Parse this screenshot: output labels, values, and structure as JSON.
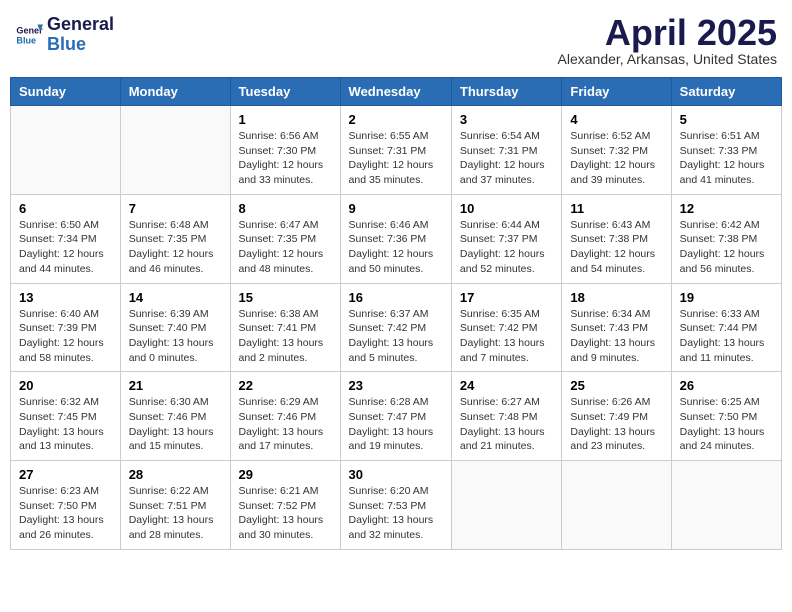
{
  "header": {
    "logo_line1": "General",
    "logo_line2": "Blue",
    "month_title": "April 2025",
    "location": "Alexander, Arkansas, United States"
  },
  "days_of_week": [
    "Sunday",
    "Monday",
    "Tuesday",
    "Wednesday",
    "Thursday",
    "Friday",
    "Saturday"
  ],
  "weeks": [
    [
      {
        "day": "",
        "info": ""
      },
      {
        "day": "",
        "info": ""
      },
      {
        "day": "1",
        "info": "Sunrise: 6:56 AM\nSunset: 7:30 PM\nDaylight: 12 hours and 33 minutes."
      },
      {
        "day": "2",
        "info": "Sunrise: 6:55 AM\nSunset: 7:31 PM\nDaylight: 12 hours and 35 minutes."
      },
      {
        "day": "3",
        "info": "Sunrise: 6:54 AM\nSunset: 7:31 PM\nDaylight: 12 hours and 37 minutes."
      },
      {
        "day": "4",
        "info": "Sunrise: 6:52 AM\nSunset: 7:32 PM\nDaylight: 12 hours and 39 minutes."
      },
      {
        "day": "5",
        "info": "Sunrise: 6:51 AM\nSunset: 7:33 PM\nDaylight: 12 hours and 41 minutes."
      }
    ],
    [
      {
        "day": "6",
        "info": "Sunrise: 6:50 AM\nSunset: 7:34 PM\nDaylight: 12 hours and 44 minutes."
      },
      {
        "day": "7",
        "info": "Sunrise: 6:48 AM\nSunset: 7:35 PM\nDaylight: 12 hours and 46 minutes."
      },
      {
        "day": "8",
        "info": "Sunrise: 6:47 AM\nSunset: 7:35 PM\nDaylight: 12 hours and 48 minutes."
      },
      {
        "day": "9",
        "info": "Sunrise: 6:46 AM\nSunset: 7:36 PM\nDaylight: 12 hours and 50 minutes."
      },
      {
        "day": "10",
        "info": "Sunrise: 6:44 AM\nSunset: 7:37 PM\nDaylight: 12 hours and 52 minutes."
      },
      {
        "day": "11",
        "info": "Sunrise: 6:43 AM\nSunset: 7:38 PM\nDaylight: 12 hours and 54 minutes."
      },
      {
        "day": "12",
        "info": "Sunrise: 6:42 AM\nSunset: 7:38 PM\nDaylight: 12 hours and 56 minutes."
      }
    ],
    [
      {
        "day": "13",
        "info": "Sunrise: 6:40 AM\nSunset: 7:39 PM\nDaylight: 12 hours and 58 minutes."
      },
      {
        "day": "14",
        "info": "Sunrise: 6:39 AM\nSunset: 7:40 PM\nDaylight: 13 hours and 0 minutes."
      },
      {
        "day": "15",
        "info": "Sunrise: 6:38 AM\nSunset: 7:41 PM\nDaylight: 13 hours and 2 minutes."
      },
      {
        "day": "16",
        "info": "Sunrise: 6:37 AM\nSunset: 7:42 PM\nDaylight: 13 hours and 5 minutes."
      },
      {
        "day": "17",
        "info": "Sunrise: 6:35 AM\nSunset: 7:42 PM\nDaylight: 13 hours and 7 minutes."
      },
      {
        "day": "18",
        "info": "Sunrise: 6:34 AM\nSunset: 7:43 PM\nDaylight: 13 hours and 9 minutes."
      },
      {
        "day": "19",
        "info": "Sunrise: 6:33 AM\nSunset: 7:44 PM\nDaylight: 13 hours and 11 minutes."
      }
    ],
    [
      {
        "day": "20",
        "info": "Sunrise: 6:32 AM\nSunset: 7:45 PM\nDaylight: 13 hours and 13 minutes."
      },
      {
        "day": "21",
        "info": "Sunrise: 6:30 AM\nSunset: 7:46 PM\nDaylight: 13 hours and 15 minutes."
      },
      {
        "day": "22",
        "info": "Sunrise: 6:29 AM\nSunset: 7:46 PM\nDaylight: 13 hours and 17 minutes."
      },
      {
        "day": "23",
        "info": "Sunrise: 6:28 AM\nSunset: 7:47 PM\nDaylight: 13 hours and 19 minutes."
      },
      {
        "day": "24",
        "info": "Sunrise: 6:27 AM\nSunset: 7:48 PM\nDaylight: 13 hours and 21 minutes."
      },
      {
        "day": "25",
        "info": "Sunrise: 6:26 AM\nSunset: 7:49 PM\nDaylight: 13 hours and 23 minutes."
      },
      {
        "day": "26",
        "info": "Sunrise: 6:25 AM\nSunset: 7:50 PM\nDaylight: 13 hours and 24 minutes."
      }
    ],
    [
      {
        "day": "27",
        "info": "Sunrise: 6:23 AM\nSunset: 7:50 PM\nDaylight: 13 hours and 26 minutes."
      },
      {
        "day": "28",
        "info": "Sunrise: 6:22 AM\nSunset: 7:51 PM\nDaylight: 13 hours and 28 minutes."
      },
      {
        "day": "29",
        "info": "Sunrise: 6:21 AM\nSunset: 7:52 PM\nDaylight: 13 hours and 30 minutes."
      },
      {
        "day": "30",
        "info": "Sunrise: 6:20 AM\nSunset: 7:53 PM\nDaylight: 13 hours and 32 minutes."
      },
      {
        "day": "",
        "info": ""
      },
      {
        "day": "",
        "info": ""
      },
      {
        "day": "",
        "info": ""
      }
    ]
  ]
}
